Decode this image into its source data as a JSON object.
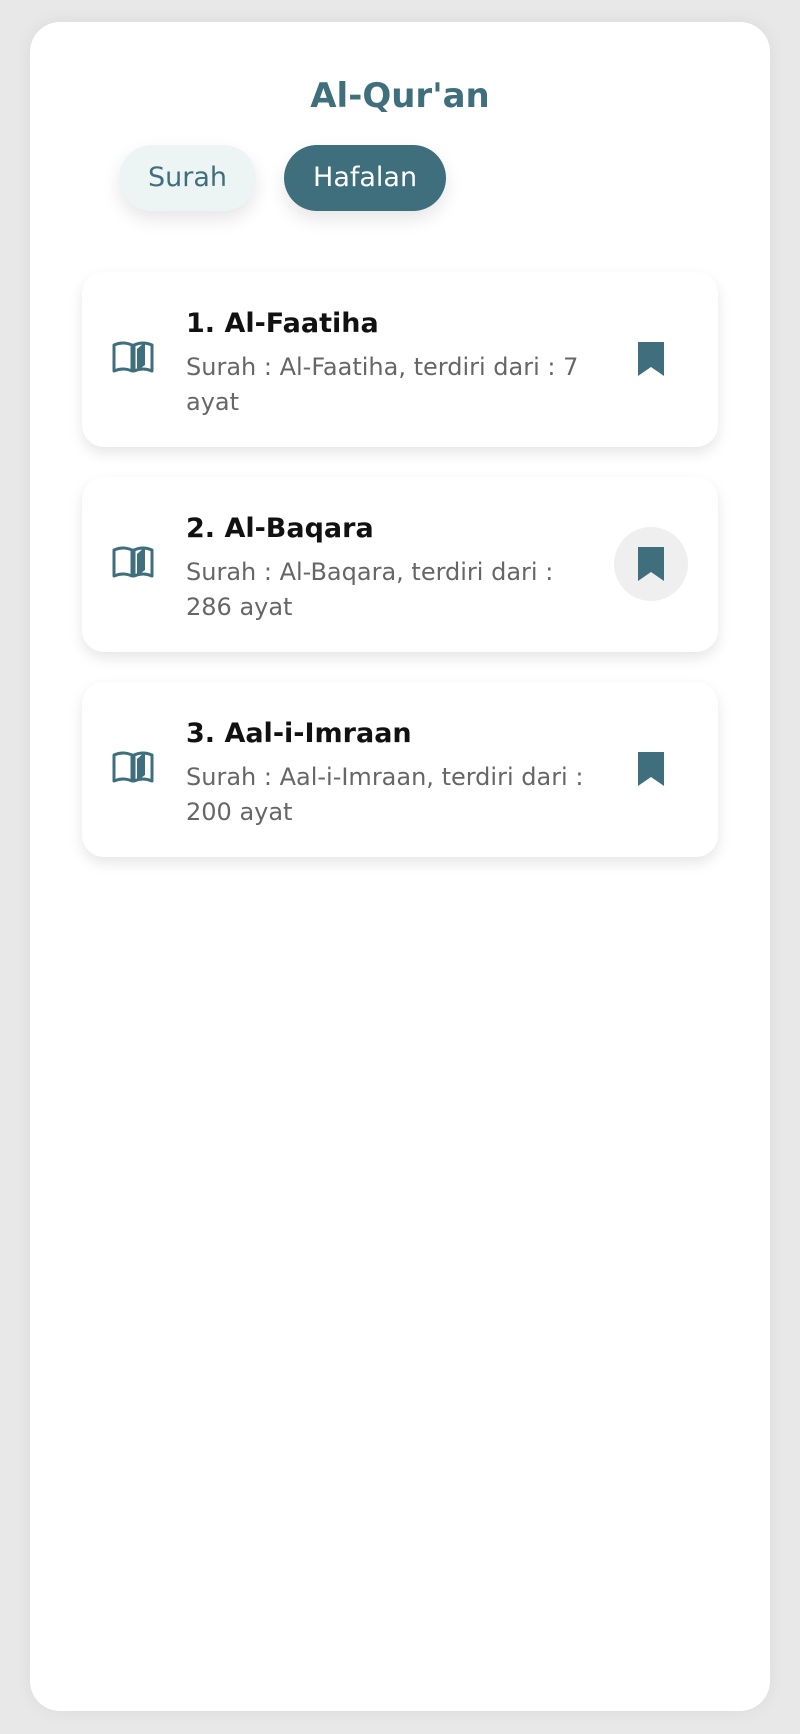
{
  "app": {
    "title": "Al-Qur'an"
  },
  "tabs": [
    {
      "label": "Surah",
      "active": false
    },
    {
      "label": "Hafalan",
      "active": true
    }
  ],
  "surahs": [
    {
      "title": "1. Al-Faatiha",
      "subtitle": "Surah : Al-Faatiha, terdiri dari : 7 ayat",
      "leading_icon": "open-book-icon",
      "trailing_icon": "bookmark-icon",
      "focused": false
    },
    {
      "title": "2. Al-Baqara",
      "subtitle": "Surah : Al-Baqara, terdiri dari : 286 ayat",
      "leading_icon": "open-book-icon",
      "trailing_icon": "bookmark-icon",
      "focused": true
    },
    {
      "title": "3. Aal-i-Imraan",
      "subtitle": "Surah : Aal-i-Imraan, terdiri dari : 200 ayat",
      "leading_icon": "open-book-icon",
      "trailing_icon": "bookmark-icon",
      "focused": false
    }
  ],
  "colors": {
    "accent": "#3f6f7d",
    "tab_inactive_bg": "#edf5f4",
    "background": "#e8e8e8",
    "surface": "#ffffff",
    "text_primary": "#111111",
    "text_secondary": "#666666"
  }
}
